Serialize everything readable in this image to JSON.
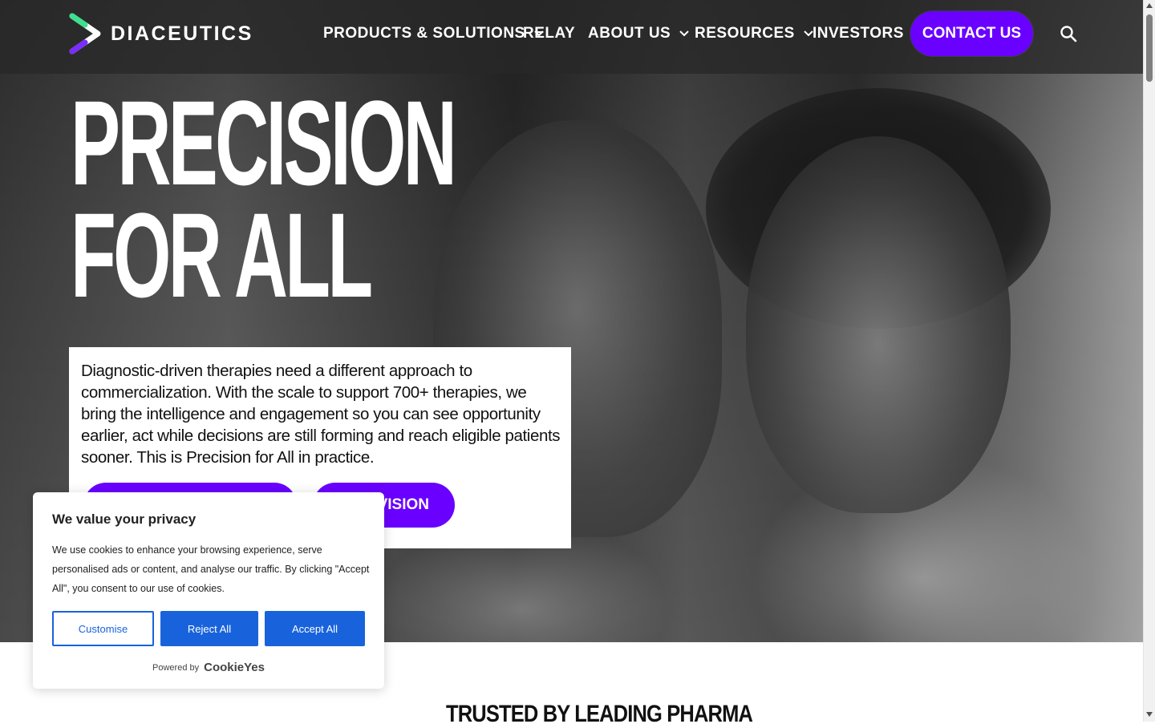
{
  "header": {
    "logo_text": "DIACEUTICS",
    "nav": [
      {
        "label": "PRODUCTS & SOLUTIONS",
        "has_dropdown": true
      },
      {
        "label": "RELAY",
        "has_dropdown": false
      },
      {
        "label": "ABOUT US",
        "has_dropdown": true
      },
      {
        "label": "RESOURCES",
        "has_dropdown": true
      },
      {
        "label": "INVESTORS",
        "has_dropdown": false
      }
    ],
    "contact_label": "CONTACT US",
    "search_icon": "search-icon"
  },
  "hero": {
    "title_line1": "PRECISION",
    "title_line2": "FOR ALL",
    "intro": "Diagnostic-driven therapies need a different approach to commercialization. With the scale to support 700+ therapies, we bring the intelligence and engagement so you can see opportunity earlier, act while decisions are still forming and reach eligible patients sooner. This is Precision for All in practice.",
    "button2_visible_label": "VISION"
  },
  "cookie_banner": {
    "title": "We value your privacy",
    "body": "We use cookies to enhance your browsing experience, serve personalised ads or content, and analyse our traffic. By clicking \"Accept All\", you consent to our use of cookies.",
    "customise_label": "Customise",
    "reject_label": "Reject All",
    "accept_label": "Accept All",
    "powered_by": "Powered by",
    "brand": "CookieYes"
  },
  "section": {
    "trusted_heading": "TRUSTED BY LEADING PHARMA"
  },
  "colors": {
    "accent_purple": "#6a00ff",
    "cookie_blue": "#1863dc",
    "logo_green": "#3ee08f",
    "logo_purple": "#7b2cff"
  }
}
